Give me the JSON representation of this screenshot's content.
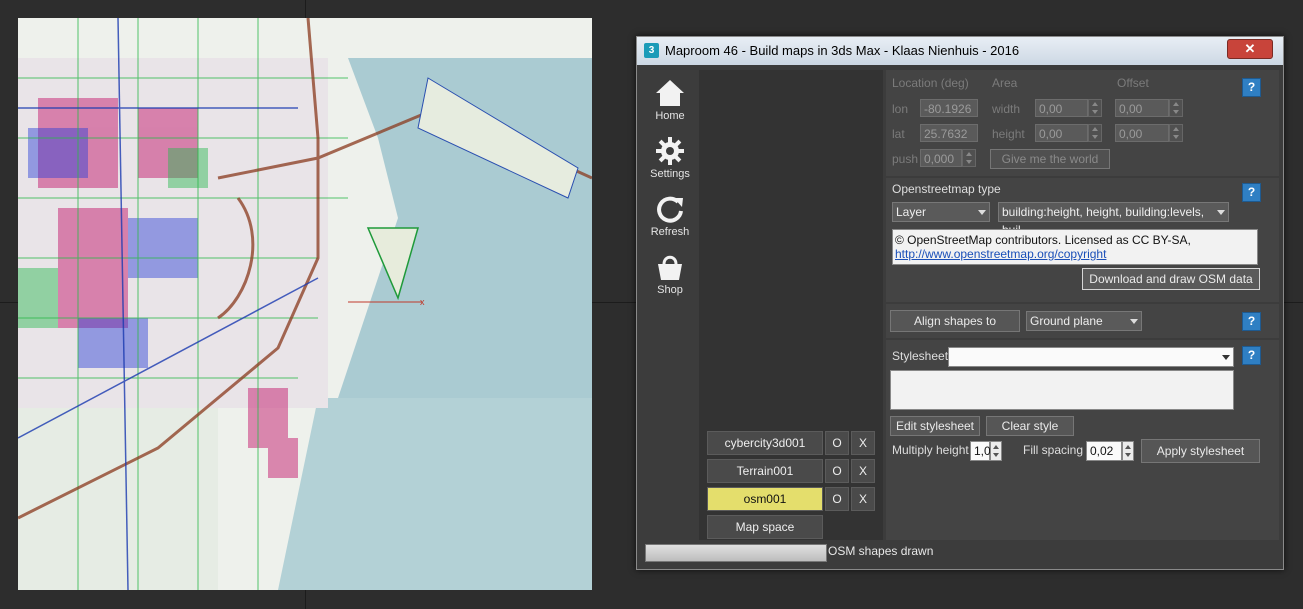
{
  "window": {
    "title": "Maproom 46 - Build maps in 3ds Max - Klaas Nienhuis - 2016",
    "logo_text": "3",
    "close_label": "✕"
  },
  "sidebar": {
    "items": [
      {
        "label": "Home",
        "icon": "home-icon"
      },
      {
        "label": "Settings",
        "icon": "gear-icon"
      },
      {
        "label": "Refresh",
        "icon": "refresh-icon"
      },
      {
        "label": "Shop",
        "icon": "basket-icon"
      }
    ]
  },
  "objects": {
    "items": [
      {
        "label": "cybercity3d001",
        "o": "O",
        "x": "X",
        "selected": false
      },
      {
        "label": "Terrain001",
        "o": "O",
        "x": "X",
        "selected": false
      },
      {
        "label": "osm001",
        "o": "O",
        "x": "X",
        "selected": true
      }
    ],
    "map_space_label": "Map space"
  },
  "location": {
    "heading_location": "Location (deg)",
    "heading_area": "Area",
    "heading_offset": "Offset",
    "lon_label": "lon",
    "lon_value": "-80.1926",
    "lat_label": "lat",
    "lat_value": "25.7632",
    "push_label": "push",
    "push_value": "0,000",
    "width_label": "width",
    "width_value": "0,00",
    "height_label": "height",
    "height_value": "0,00",
    "offset_x_value": "0,00",
    "offset_y_value": "0,00",
    "world_button": "Give me the world",
    "help": "?"
  },
  "osm": {
    "heading": "Openstreetmap type",
    "type_value": "Layer",
    "tags_value": "building:height, height, building:levels, buil...",
    "license_line1": "© OpenStreetMap contributors. Licensed as CC BY-SA,",
    "license_link": "http://www.openstreetmap.org/copyright",
    "download_button": "Download and draw OSM data",
    "help": "?"
  },
  "align": {
    "button": "Align shapes to",
    "value": "Ground plane",
    "help": "?"
  },
  "stylesheet": {
    "label": "Stylesheet",
    "value": "",
    "edit_button": "Edit stylesheet",
    "clear_button": "Clear style",
    "multiply_label": "Multiply height",
    "multiply_value": "1,0",
    "fill_label": "Fill spacing",
    "fill_value": "0,02",
    "apply_button": "Apply stylesheet",
    "help": "?"
  },
  "status": {
    "text": "OSM shapes drawn",
    "progress": 1.0
  },
  "colors": {
    "selected_object": "#e4de6c",
    "help_button": "#2f7fc3",
    "panel": "#444444"
  }
}
